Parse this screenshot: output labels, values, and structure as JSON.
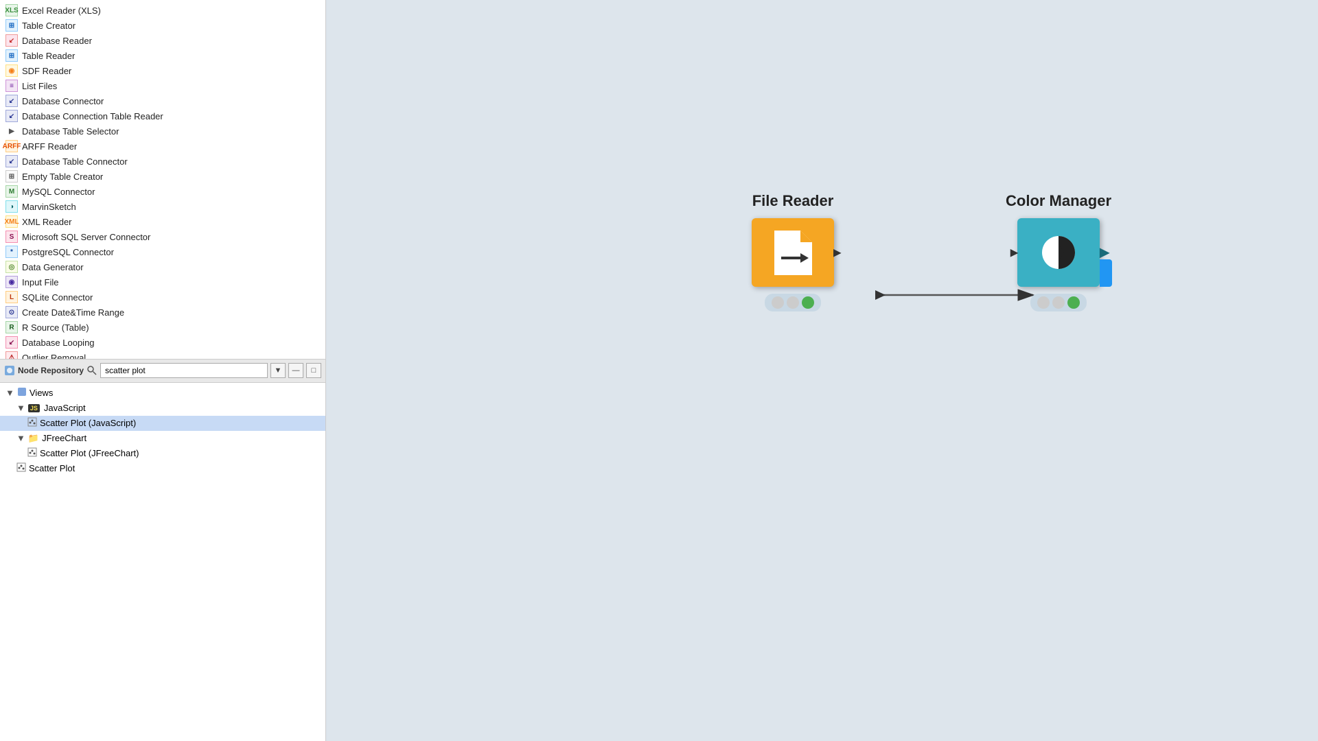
{
  "left_panel": {
    "node_list": [
      {
        "id": "excel-reader",
        "label": "Excel Reader (XLS)",
        "icon_type": "xls",
        "icon_text": "XLS"
      },
      {
        "id": "table-creator",
        "label": "Table Creator",
        "icon_type": "table",
        "icon_text": "⊞"
      },
      {
        "id": "database-reader",
        "label": "Database Reader",
        "icon_type": "db",
        "icon_text": "↙"
      },
      {
        "id": "table-reader",
        "label": "Table Reader",
        "icon_type": "table",
        "icon_text": "⊞"
      },
      {
        "id": "sdf-reader",
        "label": "SDF Reader",
        "icon_type": "sdf",
        "icon_text": "◉"
      },
      {
        "id": "list-files",
        "label": "List Files",
        "icon_type": "list",
        "icon_text": "≡"
      },
      {
        "id": "database-connector",
        "label": "Database Connector",
        "icon_type": "conn",
        "icon_text": "↙"
      },
      {
        "id": "database-connection-table-reader",
        "label": "Database Connection Table Reader",
        "icon_type": "conn",
        "icon_text": "↙"
      },
      {
        "id": "database-table-selector",
        "label": "Database Table Selector",
        "icon_type": "arrow",
        "icon_text": "▶"
      },
      {
        "id": "arff-reader",
        "label": "ARFF Reader",
        "icon_type": "arff",
        "icon_text": "ARFF"
      },
      {
        "id": "database-table-connector",
        "label": "Database Table Connector",
        "icon_type": "conn",
        "icon_text": "↙"
      },
      {
        "id": "empty-table-creator",
        "label": "Empty Table Creator",
        "icon_type": "empty",
        "icon_text": "⊞"
      },
      {
        "id": "mysql-connector",
        "label": "MySQL Connector",
        "icon_type": "mysql",
        "icon_text": "M"
      },
      {
        "id": "marvin-sketch",
        "label": "MarvinSketch",
        "icon_type": "marvin",
        "icon_text": "◑"
      },
      {
        "id": "xml-reader",
        "label": "XML Reader",
        "icon_type": "xml",
        "icon_text": "XML"
      },
      {
        "id": "mssql-connector",
        "label": "Microsoft SQL Server Connector",
        "icon_type": "mssql",
        "icon_text": "S"
      },
      {
        "id": "postgresql-connector",
        "label": "PostgreSQL Connector",
        "icon_type": "pg",
        "icon_text": "*"
      },
      {
        "id": "data-generator",
        "label": "Data Generator",
        "icon_type": "gen",
        "icon_text": "◎"
      },
      {
        "id": "input-file",
        "label": "Input File",
        "icon_type": "input",
        "icon_text": "◉"
      },
      {
        "id": "sqlite-connector",
        "label": "SQLite Connector",
        "icon_type": "sqlite",
        "icon_text": "L"
      },
      {
        "id": "create-datetime-range",
        "label": "Create Date&Time Range",
        "icon_type": "date",
        "icon_text": "⊙"
      },
      {
        "id": "r-source-table",
        "label": "R Source (Table)",
        "icon_type": "r",
        "icon_text": "R"
      },
      {
        "id": "database-looping",
        "label": "Database Looping",
        "icon_type": "dbloop",
        "icon_text": "↙"
      },
      {
        "id": "outlier-removal",
        "label": "Outlier Removal",
        "icon_type": "outlier",
        "icon_text": "⚠"
      }
    ]
  },
  "search_bar": {
    "repo_label": "Node Repository",
    "search_placeholder": "scatter plot",
    "search_value": "scatter plot",
    "filter_icon": "▼",
    "minimize_icon": "—",
    "maximize_icon": "□"
  },
  "tree_panel": {
    "items": [
      {
        "id": "views-root",
        "label": "Views",
        "level": 1,
        "type": "tree-root",
        "icon": "▼"
      },
      {
        "id": "javascript-folder",
        "label": "JavaScript",
        "level": 2,
        "type": "folder",
        "icon": "▼"
      },
      {
        "id": "scatter-plot-js",
        "label": "Scatter Plot (JavaScript)",
        "level": 3,
        "type": "node",
        "selected": true
      },
      {
        "id": "jfreechart-folder",
        "label": "JFreeChart",
        "level": 2,
        "type": "folder",
        "icon": "▼"
      },
      {
        "id": "scatter-plot-jfree",
        "label": "Scatter Plot (JFreeChart)",
        "level": 3,
        "type": "node"
      },
      {
        "id": "scatter-plot",
        "label": "Scatter Plot",
        "level": 2,
        "type": "node"
      }
    ]
  },
  "workflow": {
    "file_reader": {
      "label": "File Reader",
      "type": "orange",
      "status_dots": [
        "gray",
        "light-gray",
        "green"
      ]
    },
    "color_manager": {
      "label": "Color Manager",
      "type": "teal",
      "status_dots": [
        "gray",
        "light-gray",
        "green"
      ]
    }
  }
}
